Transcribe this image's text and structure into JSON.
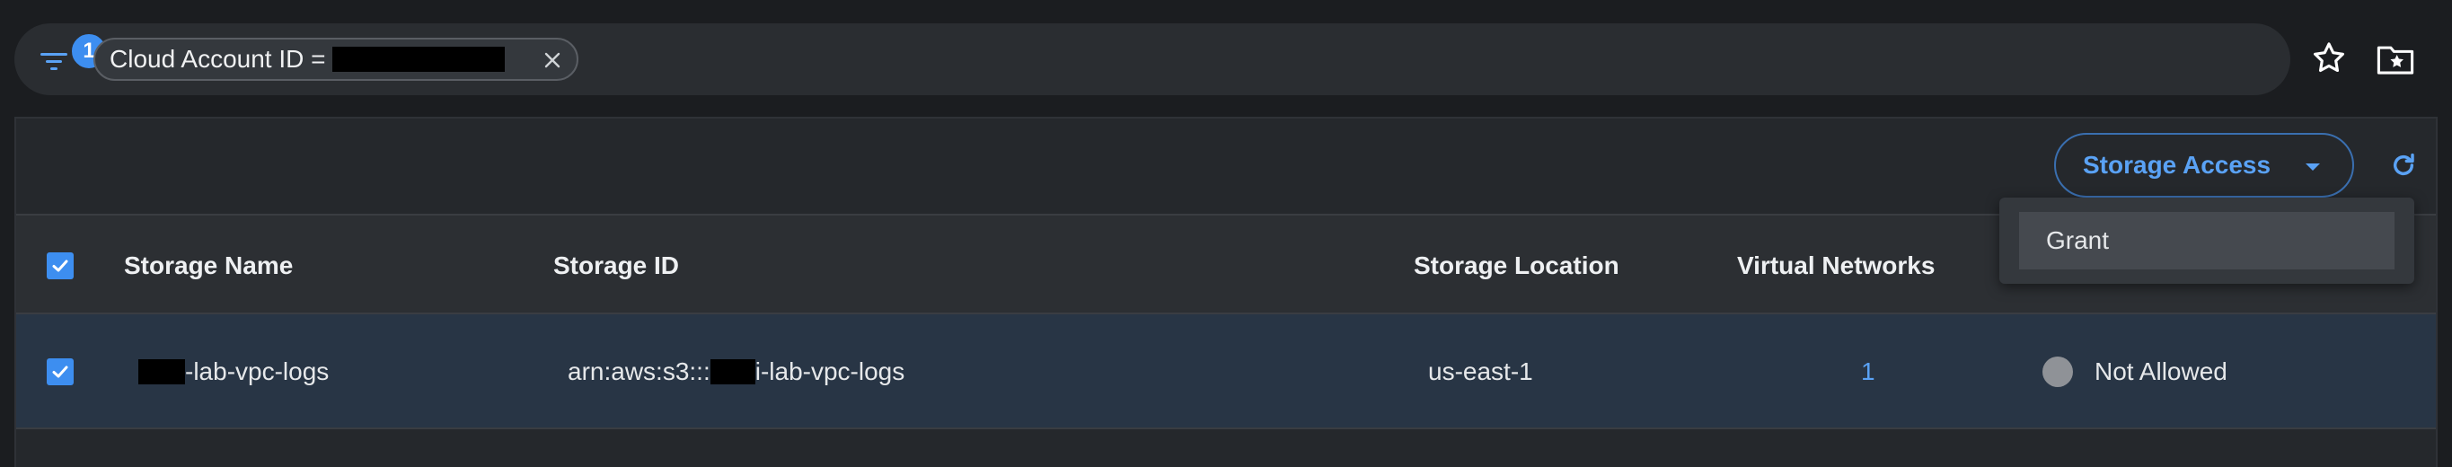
{
  "filter": {
    "count": "1",
    "chip_label": "Cloud Account ID ="
  },
  "toolbar": {
    "storage_access_label": "Storage Access"
  },
  "menu": {
    "items": [
      "Grant"
    ]
  },
  "table": {
    "headers": {
      "storage_name": "Storage Name",
      "storage_id": "Storage ID",
      "storage_location": "Storage Location",
      "virtual_networks": "Virtual Networks"
    },
    "rows": [
      {
        "storage_name_suffix": "-lab-vpc-logs",
        "storage_id_prefix": "arn:aws:s3:::",
        "storage_id_suffix": "i-lab-vpc-logs",
        "storage_location": "us-east-1",
        "virtual_networks": "1",
        "access_status": "Not Allowed"
      }
    ]
  },
  "colors": {
    "accent": "#3d8ef0",
    "link": "#5aa2f5",
    "selected_row": "#283545",
    "status_neutral": "#8f9297"
  },
  "icons": {
    "filter": "filter-icon",
    "chip_close": "close-icon",
    "favorite": "star-icon",
    "saved": "folder-star-icon",
    "refresh": "refresh-icon",
    "checkbox": "check-icon"
  }
}
